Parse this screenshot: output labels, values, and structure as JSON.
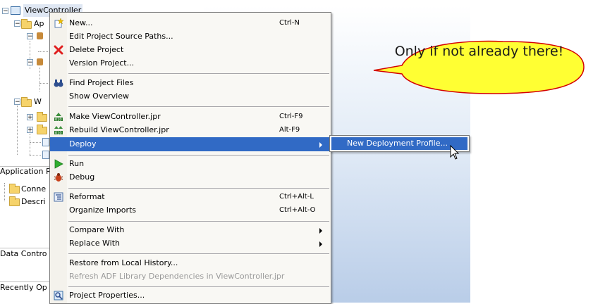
{
  "navigator": {
    "root_label": "ViewController",
    "tree_fragments": [
      "Ap",
      "W"
    ],
    "sections": [
      {
        "label": "Application R"
      },
      {
        "label": "Data Contro"
      },
      {
        "label": "Recently Op"
      }
    ],
    "resources": [
      {
        "label": "Conne"
      },
      {
        "label": "Descri"
      }
    ]
  },
  "context_menu": {
    "items": [
      {
        "label": "New...",
        "accel": "Ctrl-N",
        "icon": "new-icon"
      },
      {
        "label": "Edit Project Source Paths...",
        "accel": ""
      },
      {
        "label": "Delete Project",
        "accel": "",
        "icon": "delete-x-icon"
      },
      {
        "label": "Version Project...",
        "accel": ""
      },
      {
        "label": "Find Project Files",
        "accel": "",
        "icon": "binoculars-icon"
      },
      {
        "label": "Show Overview",
        "accel": ""
      },
      {
        "label": "Make ViewController.jpr",
        "accel": "Ctrl-F9",
        "icon": "make-icon"
      },
      {
        "label": "Rebuild ViewController.jpr",
        "accel": "Alt-F9",
        "icon": "rebuild-icon"
      },
      {
        "label": "Deploy",
        "accel": "",
        "submenu": true,
        "highlighted": true
      },
      {
        "label": "Run",
        "accel": "",
        "icon": "run-icon"
      },
      {
        "label": "Debug",
        "accel": "",
        "icon": "debug-icon"
      },
      {
        "label": "Reformat",
        "accel": "Ctrl+Alt-L",
        "icon": "reformat-icon"
      },
      {
        "label": "Organize Imports",
        "accel": "Ctrl+Alt-O"
      },
      {
        "label": "Compare With",
        "accel": "",
        "submenu": true
      },
      {
        "label": "Replace With",
        "accel": "",
        "submenu": true
      },
      {
        "label": "Restore from Local History...",
        "accel": ""
      },
      {
        "label": "Refresh ADF Library Dependencies in ViewController.jpr",
        "accel": "",
        "disabled": true
      },
      {
        "label": "Project Properties...",
        "accel": "",
        "icon": "properties-icon"
      }
    ]
  },
  "deploy_submenu": {
    "items": [
      {
        "label": "New Deployment Profile..."
      }
    ]
  },
  "callout": {
    "text": "Only if not already there!",
    "fill": "#ffff33",
    "border": "#d40000"
  },
  "colors": {
    "highlight": "#316ac5",
    "menu_bg": "#f9f8f4"
  }
}
